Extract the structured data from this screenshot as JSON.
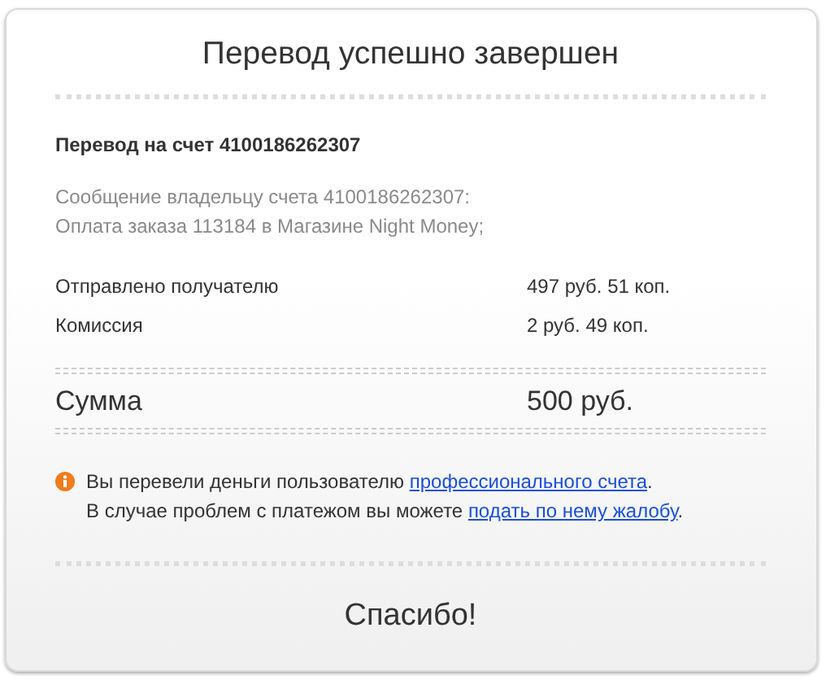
{
  "title": "Перевод успешно завершен",
  "transfer_heading": "Перевод на счет 4100186262307",
  "message": [
    "Сообщение владельцу счета 4100186262307:",
    "Оплата заказа 113184 в Магазине Night Money;"
  ],
  "details": [
    {
      "label": "Отправлено получателю",
      "value": "497 руб. 51 коп."
    },
    {
      "label": "Комиссия",
      "value": "2 руб. 49 коп."
    }
  ],
  "total": {
    "label": "Сумма",
    "value": "500 руб."
  },
  "notice": [
    {
      "before": "Вы перевели деньги пользователю ",
      "link": "профессионального счета",
      "after": "."
    },
    {
      "before": "В случае проблем с платежом вы можете ",
      "link": "подать по нему жалобу",
      "after": "."
    }
  ],
  "footer": "Спасибо!"
}
